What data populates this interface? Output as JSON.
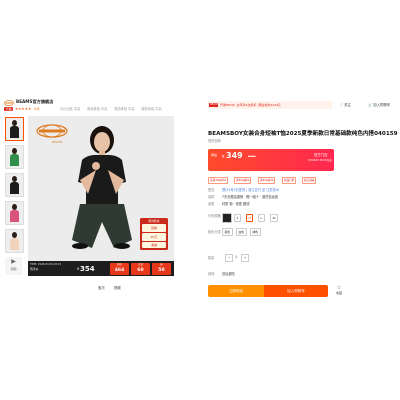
{
  "store": {
    "name": "BEAMS官方旗舰店",
    "badge": "天猫",
    "stars": "★★★★★",
    "score": "4.8",
    "metrics": [
      "平价出品 中高",
      "商品体验 中高",
      "物流体验 中高",
      "服务体验 中高"
    ]
  },
  "thumbnails": [
    {
      "body_color": "#1c1c1c"
    },
    {
      "body_color": "#2f8f4a"
    },
    {
      "body_color": "#1c1c1c"
    },
    {
      "body_color": "#d9537a"
    },
    {
      "body_color": "#f1d3bb"
    }
  ],
  "thumb_video_label": "视频",
  "main_image": {
    "brand_small": "BEAMS",
    "promo_head": "限时秒杀",
    "promo_cells": [
      "领券",
      "20元",
      "满减"
    ],
    "strip_time": "TIME: 2026.03.09-03.15",
    "strip_label": "到手价",
    "strip_yen": "¥",
    "strip_price": "354",
    "strip_cells": [
      {
        "label": "原价",
        "value": "464"
      },
      {
        "label": "立减",
        "value": "60"
      },
      {
        "label": "券",
        "value": "50"
      }
    ]
  },
  "under_buttons": [
    "宝贝",
    "视频"
  ],
  "promo_banner": {
    "tag": "88VIP",
    "text": "开通88VIP, 全年享5次折扣, 预估省约3434元"
  },
  "top_actions": {
    "follow": "♡ 关注",
    "cart": "🛒 加入购物车"
  },
  "title": "BEAMSBOY女装合身短袖T恤2025夏季新款日常基础款纯色内搭040159",
  "shipping_note": "现货包邮",
  "price": {
    "label": "券后",
    "yen": "¥",
    "value": "349",
    "original": "¥464",
    "side_label": "官方门店",
    "side_time": "2/5/2025 18:00 结束"
  },
  "coupons": [
    "每满300减30",
    "满300减60",
    "满400减40",
    "新品打折",
    "跨店满减"
  ],
  "rows": {
    "delivery_label": "配送",
    "delivery_value": "预计3月5日发货 | 浙江嘉兴 至 江苏苏州",
    "service_label": "保障",
    "service_value": "7天无理由退换 · 假一赔十 · 退货包运费",
    "params_label": "参数",
    "params_value": "材质 棉 · 领型 圆领",
    "size_label": "尺码规格",
    "sizes": [
      "S",
      "M",
      "L",
      "XL"
    ],
    "size_selected_index": 1,
    "color_label": "颜色分类",
    "colors": [
      "黑色",
      "白色",
      "绿色"
    ],
    "qty_label": "数量",
    "qty_minus": "−",
    "qty_value": "1",
    "qty_plus": "+",
    "extra_label": "其他",
    "extra_value": "送运费险"
  },
  "buttons": {
    "buy": "立即购买",
    "addcart": "加入购物车",
    "collect": "收藏"
  }
}
